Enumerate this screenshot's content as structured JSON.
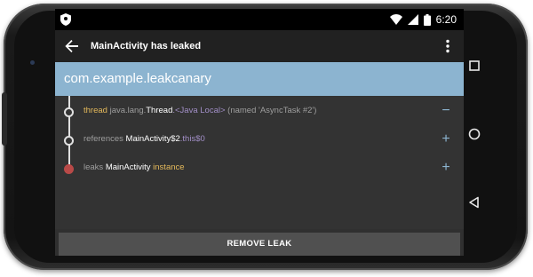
{
  "status_bar": {
    "time": "6:20",
    "icons": [
      "shield-icon",
      "wifi-icon",
      "signal-icon",
      "battery-icon"
    ]
  },
  "app_bar": {
    "title": "MainActivity has leaked",
    "back_icon": "arrow-left-icon",
    "overflow_icon": "more-vert-icon"
  },
  "header": {
    "package": "com.example.leakcanary"
  },
  "trace": [
    {
      "segments": [
        {
          "text": "thread",
          "style": "yellow"
        },
        {
          "text": " java.lang.",
          "style": "gray"
        },
        {
          "text": "Thread",
          "style": "white"
        },
        {
          "text": ".<Java Local>",
          "style": "purple"
        },
        {
          "text": " (named 'AsyncTask #2')",
          "style": "gray"
        }
      ],
      "action": "−",
      "node": "open"
    },
    {
      "segments": [
        {
          "text": "references ",
          "style": "gray"
        },
        {
          "text": "MainActivity$2",
          "style": "white"
        },
        {
          "text": ".this$0",
          "style": "purple"
        }
      ],
      "action": "+",
      "node": "open"
    },
    {
      "segments": [
        {
          "text": "leaks ",
          "style": "gray"
        },
        {
          "text": "MainActivity",
          "style": "white"
        },
        {
          "text": " instance",
          "style": "yellow"
        }
      ],
      "action": "+",
      "node": "red"
    }
  ],
  "bottom_button": "REMOVE LEAK",
  "nav_buttons": [
    "recents-square-icon",
    "home-circle-icon",
    "back-triangle-icon"
  ],
  "colors": {
    "header": "#8cb4d0",
    "background": "#303030",
    "accent_yellow": "#e4b95b",
    "accent_purple": "#a28fc7",
    "leak_node": "#b94a48"
  }
}
